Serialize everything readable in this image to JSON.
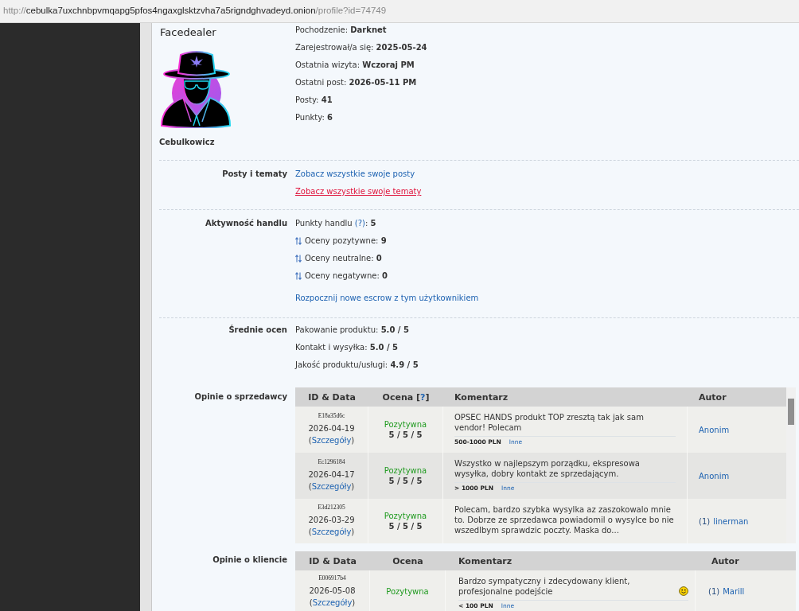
{
  "address_bar": {
    "scheme": "http://",
    "host": "cebulka7uxchnbpvmqapg5pfos4ngaxglsktzvha7a5rigndghvadeyd.onion",
    "path": "/profile?id=74749"
  },
  "profile": {
    "username": "Facedealer",
    "rank": "Cebulkowicz",
    "info": [
      {
        "label": "Pochodzenie:",
        "value": "Darknet"
      },
      {
        "label": "Zarejestrował/a się:",
        "value": "2025-05-24"
      },
      {
        "label": "Ostatnia wizyta:",
        "value": "Wczoraj PM"
      },
      {
        "label": "Ostatni post:",
        "value": "2026-05-11 PM"
      },
      {
        "label": "Posty:",
        "value": "41"
      },
      {
        "label": "Punkty:",
        "value": "6"
      }
    ]
  },
  "posts_topics": {
    "label": "Posty i tematy",
    "links": [
      {
        "text": "Zobacz wszystkie swoje posty",
        "hovered": false
      },
      {
        "text": "Zobacz wszystkie swoje tematy",
        "hovered": true
      }
    ]
  },
  "trade_activity": {
    "label": "Aktywność handlu",
    "points": {
      "label": "Punkty handlu",
      "help": "(?)",
      "suffix": ":",
      "value": "5"
    },
    "ratings": [
      {
        "label": "Oceny pozytywne:",
        "value": "9"
      },
      {
        "label": "Oceny neutralne:",
        "value": "0"
      },
      {
        "label": "Oceny negatywne:",
        "value": "0"
      }
    ],
    "escrow_link": "Rozpocznij nowe escrow z tym użytkownikiem"
  },
  "rating_averages": {
    "label": "Średnie ocen",
    "lines": [
      {
        "label": "Pakowanie produktu:",
        "value": "5.0 / 5"
      },
      {
        "label": "Kontakt i wysyłka:",
        "value": "5.0 / 5"
      },
      {
        "label": "Jakość produktu/usługi:",
        "value": "4.9 / 5"
      }
    ]
  },
  "seller_reviews": {
    "label": "Opinie o sprzedawcy",
    "columns": [
      {
        "title": "ID & Data"
      },
      {
        "title": "Ocena [",
        "help": "?",
        "suffix": "]"
      },
      {
        "title": "Komentarz"
      },
      {
        "title": "Autor"
      }
    ],
    "rows": [
      {
        "id": "E18a35d6c",
        "date": "2026-04-19",
        "details": {
          "open": "(",
          "text": "Szczegóły",
          "close": ")"
        },
        "rating": {
          "label": "Pozytywna",
          "kind": "positive",
          "scores": "5 / 5 / 5"
        },
        "comment": "OPSEC HANDS produkt TOP zresztą tak jak sam vendor! Polecam",
        "amount": "500-1000 PLN",
        "category": "Inne",
        "author": {
          "name": "Anonim"
        }
      },
      {
        "id": "Ec1296184",
        "date": "2026-04-17",
        "details": {
          "open": "(",
          "text": "Szczegóły",
          "close": ")"
        },
        "rating": {
          "label": "Pozytywna",
          "kind": "positive",
          "scores": "5 / 5 / 5"
        },
        "comment": "Wszystko w najlepszym porządku, ekspresowa wysyłka, dobry kontakt ze sprzedającym.",
        "amount": "> 1000 PLN",
        "category": "Inne",
        "author": {
          "name": "Anonim"
        }
      },
      {
        "id": "E3d212305",
        "date": "2026-03-29",
        "details": {
          "open": "(",
          "text": "Szczegóły",
          "close": ")"
        },
        "rating": {
          "label": "Pozytywna",
          "kind": "positive",
          "scores": "5 / 5 / 5"
        },
        "comment": "Polecam, bardzo szybka wysylka az zaszokowalo mnie to. Dobrze ze sprzedawca powiadomil o wysylce bo nie wszedlbym sprawdzic poczty. Maska do...",
        "author": {
          "count": "(1)",
          "name": "linerman"
        }
      }
    ]
  },
  "client_reviews": {
    "label": "Opinie o kliencie",
    "columns": [
      {
        "title": "ID & Data"
      },
      {
        "title": "Ocena"
      },
      {
        "title": "Komentarz"
      },
      {
        "title": "Autor"
      }
    ],
    "rows": [
      {
        "id": "E006917b4",
        "date": "2026-05-08",
        "details": {
          "open": "(",
          "text": "Szczegóły",
          "close": ")"
        },
        "rating": {
          "label": "Pozytywna",
          "kind": "positive"
        },
        "comment": "Bardzo sympatyczny i zdecydowany klient, profesjonalne podejście",
        "emoticon": true,
        "amount": "< 100 PLN",
        "category": "Inne",
        "author": {
          "count": "(1)",
          "name": "Marill"
        }
      }
    ]
  }
}
